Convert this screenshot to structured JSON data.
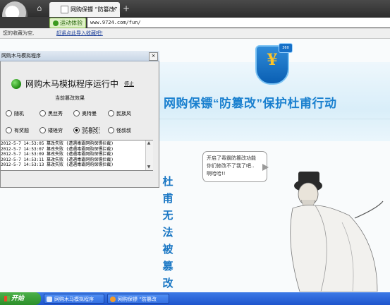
{
  "browser": {
    "home_icon": "home-icon",
    "tab_title": "网购保镖 “防篡改” 技",
    "tab_close": "×",
    "new_tab": "+",
    "ssl_badge": "运动体验",
    "url": "www.9724.com/fun/",
    "favbar_hint": "您的收藏为空,",
    "favbar_link": "赶紧点此导入收藏吧!"
  },
  "banner": {
    "title": "网购保镖“防篡改”保护杜甫行动",
    "shield_symbol": "¥",
    "shield_tag": "360"
  },
  "slogan": [
    "杜",
    "甫",
    "无",
    "法",
    "被",
    "篡",
    "改"
  ],
  "bubble": {
    "lines": [
      "开启了毒霸防篡改功能",
      "你们修改不了我了吧..",
      "啊哈哈!!"
    ]
  },
  "dialog": {
    "title": "网购木马模拟程序",
    "close": "×",
    "status": "网购木马模拟程序运行中",
    "stop": "停止",
    "effect_label": "当前篡改效果",
    "options": [
      {
        "label": "随机",
        "selected": false
      },
      {
        "label": "黑丝秀",
        "selected": false
      },
      {
        "label": "奥特曼",
        "selected": false
      },
      {
        "label": "民族风",
        "selected": false
      },
      {
        "label": "有奖题",
        "selected": false
      },
      {
        "label": "矮矬穷",
        "selected": false
      },
      {
        "label": "防篡改",
        "selected": true
      },
      {
        "label": "怪叔叔",
        "selected": false
      }
    ],
    "log": [
      "2012-5-7 14:53:05   篡改失败 (遭遇毒霸网购保镖拦截)",
      "2012-5-7 14:53:07   篡改失败 (遭遇毒霸网购保镖拦截)",
      "2012-5-7 14:53:09   篡改失败 (遭遇毒霸网购保镖拦截)",
      "2012-5-7 14:53:11   篡改失败 (遭遇毒霸网购保镖拦截)",
      "2012-5-7 14:53:13   篡改失败 (遭遇毒霸网购保镖拦截)"
    ]
  },
  "taskbar": {
    "start": "开始",
    "tasks": [
      "网购木马模拟程序",
      "网购保镖 “防篡改"
    ]
  },
  "colors": {
    "banner_blue": "#1a80cf",
    "taskbar": "#1f55cd",
    "start_green": "#2c8f2a"
  }
}
